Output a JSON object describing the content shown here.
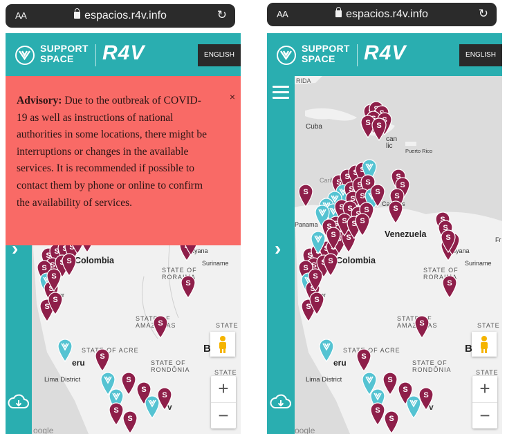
{
  "colors": {
    "brand": "#2aaeb0",
    "advisory_bg": "#f96a66",
    "pin_service": "#8e1f4a",
    "pin_support": "#55c3d2",
    "land": "#f1f1f1",
    "water": "#dcdcdc"
  },
  "browser": {
    "aa_label": "AA",
    "url": "espacios.r4v.info"
  },
  "header": {
    "brand_line1": "SUPPORT",
    "brand_line2": "SPACE",
    "brand_logo": "R4V",
    "language_button": "ENGLISH"
  },
  "advisory": {
    "title": "Advisory:",
    "body": "Due to the outbreak of COVID-19 as well as instructions of national authorities in some locations, there might be interruptions or changes in the available services. It is recommended if possible to contact them by phone or online to confirm the availability of services.",
    "close": "×"
  },
  "map": {
    "pin_glyph": "S",
    "labels": {
      "colombia": "Colombia",
      "peru": "eru",
      "lima": "Lima District",
      "guyana": "uyana",
      "suriname": "Suriname",
      "state_roraima_l1": "STATE OF",
      "state_roraima_l2": "RORAIMA",
      "state_amazonas_l1": "STATE OF",
      "state_amazonas_l2": "AMAZONAS",
      "state_acre": "STATE OF ACRE",
      "state_rondonia_l1": "STATE OF",
      "state_rondonia_l2": "RONDÔNIA",
      "state_right_1": "STATE",
      "state_right_2": "STATE OF",
      "brazil_b": "B",
      "ador": "ador",
      "cuba": "Cuba",
      "puerto_rico": "Puerto Rico",
      "venezuela": "Venezuela",
      "caracas": "Caracas",
      "panama": "Panama",
      "caribbean": "Caribb",
      "florida": "RIDA",
      "fr": "Fr",
      "can": "can",
      "lic": "lic",
      "wedge": "v",
      "google": "oogle"
    },
    "zoom_in": "+",
    "zoom_out": "−"
  },
  "icons": {
    "menu": "hamburger-icon",
    "expand": "chevron-right-icon",
    "download": "cloud-download-icon",
    "street_view": "pegman-icon",
    "logo": "support-space-logo-icon"
  }
}
